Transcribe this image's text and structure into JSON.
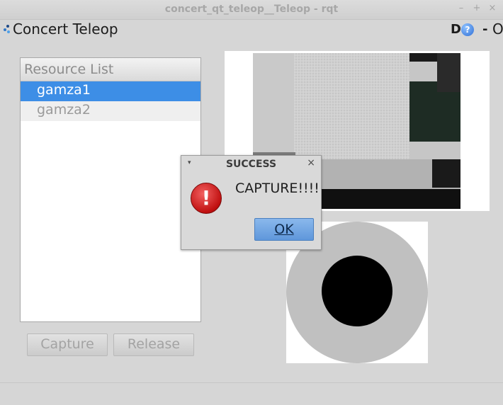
{
  "window": {
    "title": "concert_qt_teleop__Teleop - rqt",
    "minimize_glyph": "–",
    "maximize_glyph": "+",
    "close_glyph": "×"
  },
  "plugin": {
    "title": "Concert Teleop",
    "icon": "ros-plugin-icon",
    "d_label": "D",
    "help_label": "?",
    "dash_label": "-",
    "o_label": "O"
  },
  "resource_list": {
    "header": "Resource List",
    "items": [
      {
        "label": "gamza1",
        "selected": true
      },
      {
        "label": "gamza2",
        "selected": false
      }
    ]
  },
  "buttons": {
    "capture": "Capture",
    "release": "Release"
  },
  "dialog": {
    "title": "SUCCESS",
    "message": "CAPTURE!!!!",
    "ok_label": "OK",
    "icon": "error-icon",
    "icon_glyph": "!",
    "menu_glyph": "▾",
    "close_glyph": "×"
  },
  "colors": {
    "selection": "#3d8ee6",
    "joystick_outer": "#c0c0c0",
    "joystick_inner": "#000000"
  }
}
